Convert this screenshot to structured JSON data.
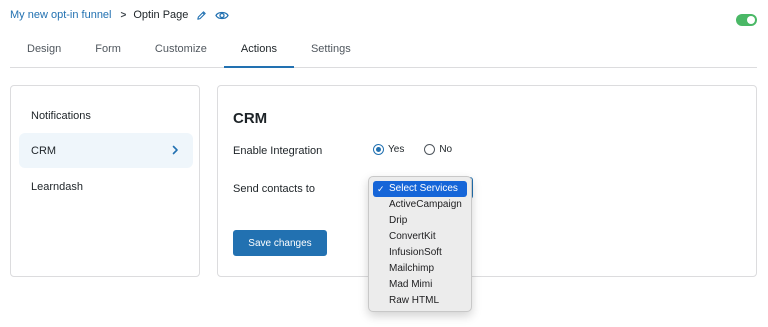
{
  "breadcrumb": {
    "parent": "My new opt-in funnel",
    "separator": ">",
    "current": "Optin Page",
    "edit_icon": "pencil-icon",
    "view_icon": "eye-icon"
  },
  "status_toggle": {
    "on": true,
    "color": "#4ab866"
  },
  "tabs": [
    {
      "label": "Design",
      "active": false
    },
    {
      "label": "Form",
      "active": false
    },
    {
      "label": "Customize",
      "active": false
    },
    {
      "label": "Actions",
      "active": true
    },
    {
      "label": "Settings",
      "active": false
    }
  ],
  "sidebar": {
    "items": [
      {
        "label": "Notifications",
        "active": false
      },
      {
        "label": "CRM",
        "active": true,
        "icon": "chevron-right-icon"
      },
      {
        "label": "Learndash",
        "active": false
      }
    ]
  },
  "crm": {
    "title": "CRM",
    "enable_label": "Enable Integration",
    "yes_label": "Yes",
    "no_label": "No",
    "enabled": "Yes",
    "send_label": "Send contacts to",
    "save_label": "Save changes",
    "services_select": {
      "selected": "Select Services",
      "options": [
        "Select Services",
        "ActiveCampaign",
        "Drip",
        "ConvertKit",
        "InfusionSoft",
        "Mailchimp",
        "Mad Mimi",
        "Raw HTML"
      ]
    }
  },
  "colors": {
    "accent": "#2271b1",
    "selected_option": "#1565d8",
    "active_menu_bg": "#eff6fb"
  }
}
